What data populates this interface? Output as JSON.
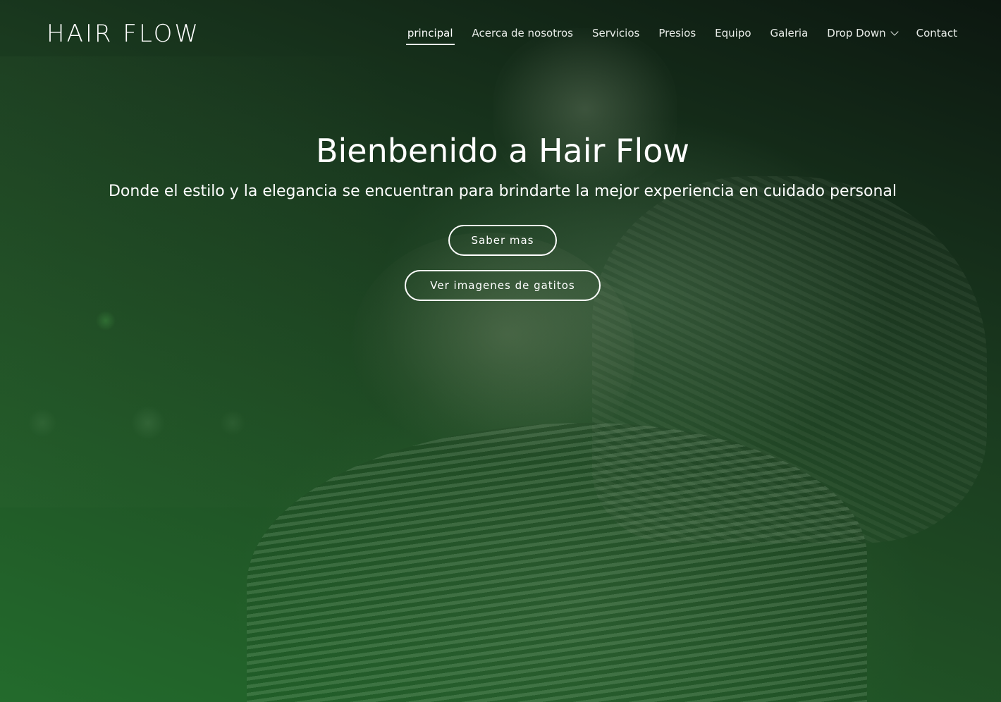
{
  "brand": {
    "logo_text": "HAIR FLOW"
  },
  "nav": {
    "items": [
      {
        "label": "principal",
        "active": true
      },
      {
        "label": "Acerca de nosotros"
      },
      {
        "label": "Servicios"
      },
      {
        "label": "Presios"
      },
      {
        "label": "Equipo"
      },
      {
        "label": "Galeria"
      },
      {
        "label": "Drop Down",
        "icon": "chevron-down-icon"
      },
      {
        "label": "Contact"
      }
    ]
  },
  "hero": {
    "title": "Bienbenido a Hair Flow",
    "subtitle": "Donde el estilo y la elegancia se encuentran para brindarte la mejor experiencia en cuidado personal",
    "buttons": [
      {
        "label": "Saber mas"
      },
      {
        "label": "Ver imagenes de gatitos"
      }
    ],
    "overlay_color": "#236b2c",
    "text_color": "#ffffff"
  }
}
